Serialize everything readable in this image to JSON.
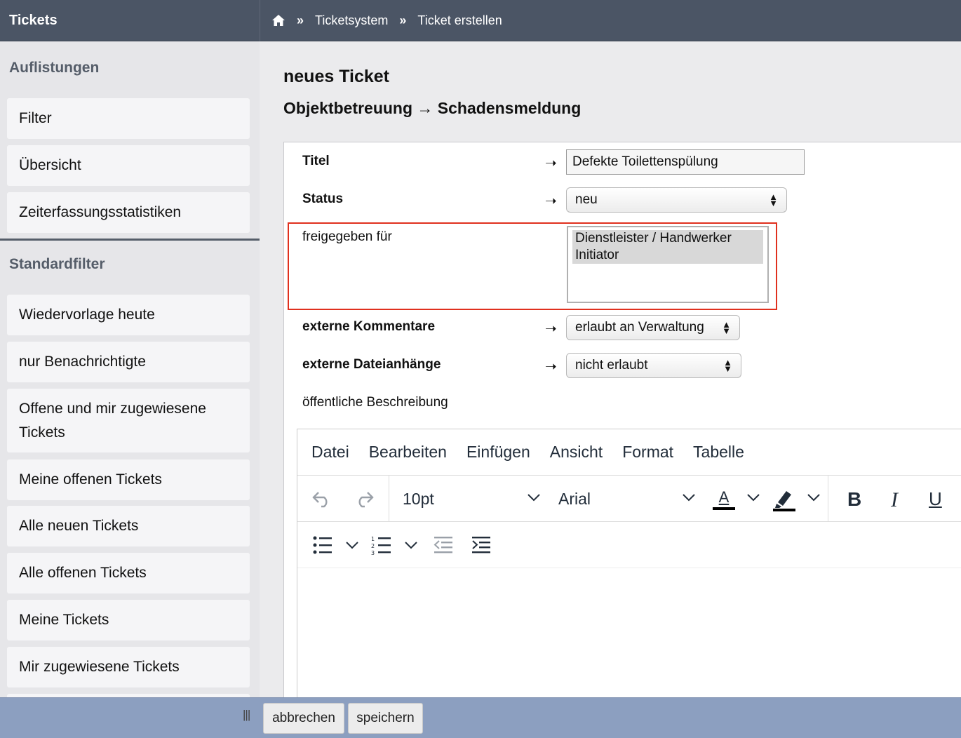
{
  "app": {
    "title": "Tickets"
  },
  "breadcrumb": {
    "items": [
      "Ticketsystem",
      "Ticket erstellen"
    ],
    "separator": "»"
  },
  "sidebar": {
    "sections": [
      {
        "heading": "Auflistungen",
        "items": [
          "Filter",
          "Übersicht",
          "Zeiterfassungsstatistiken"
        ]
      },
      {
        "heading": "Standardfilter",
        "items": [
          "Wiedervorlage heute",
          "nur Benachrichtigte",
          "Offene und mir zugewiesene Tickets",
          "Meine offenen Tickets",
          "Alle neuen Tickets",
          "Alle offenen Tickets",
          "Meine Tickets",
          "Mir zugewiesene Tickets"
        ]
      }
    ]
  },
  "main": {
    "title": "neues Ticket",
    "subtitle": "Objektbetreuung → Schadensmeldung"
  },
  "form": {
    "title_label": "Titel",
    "title_value": "Defekte Toilettenspülung",
    "status_label": "Status",
    "status_value": "neu",
    "shared_label": "freigegeben für",
    "shared_options": [
      "Dienstleister / Handwerker",
      "Initiator"
    ],
    "comments_label": "externe Kommentare",
    "comments_value": "erlaubt an Verwaltung",
    "attachments_label": "externe Dateianhänge",
    "attachments_value": "nicht erlaubt",
    "description_label": "öffentliche Beschreibung",
    "arrow": "➝"
  },
  "editor": {
    "menu": [
      "Datei",
      "Bearbeiten",
      "Einfügen",
      "Ansicht",
      "Format",
      "Tabelle"
    ],
    "font_size": "10pt",
    "font_family": "Arial",
    "bold": "B",
    "italic": "I",
    "underline": "U",
    "text_color_glyph": "A"
  },
  "footer": {
    "cancel_label": "abbrechen",
    "save_label": "speichern",
    "grip": "|||"
  },
  "colors": {
    "topbar": "#4b5565",
    "bottombar": "#8c9fc0",
    "highlight": "#e0301e"
  }
}
